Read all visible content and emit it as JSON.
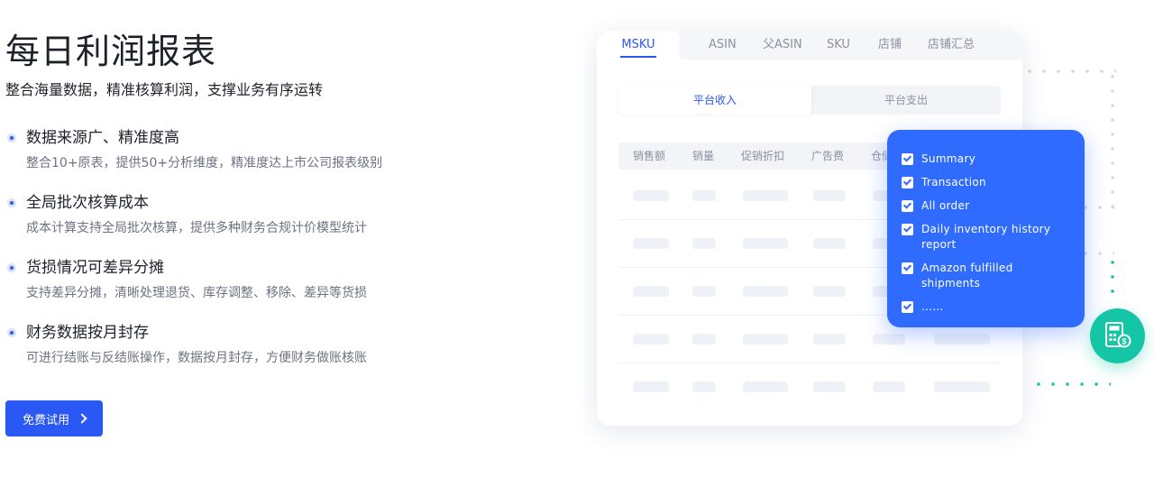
{
  "hero": {
    "title": "每日利润报表",
    "subtitle": "整合海量数据，精准核算利润，支撑业务有序运转"
  },
  "features": [
    {
      "title": "数据来源广、精准度高",
      "desc": "整合10+原表，提供50+分析维度，精准度达上市公司报表级别"
    },
    {
      "title": "全局批次核算成本",
      "desc": "成本计算支持全局批次核算，提供多种财务合规计价模型统计"
    },
    {
      "title": "货损情况可差异分摊",
      "desc": "支持差异分摊，清晰处理退货、库存调整、移除、差异等货损"
    },
    {
      "title": "财务数据按月封存",
      "desc": "可进行结账与反结账操作，数据按月封存，方便财务做账核账"
    }
  ],
  "cta": {
    "label": "免费试用"
  },
  "report_card": {
    "tabs": [
      "MSKU",
      "ASIN",
      "父ASIN",
      "SKU",
      "店铺",
      "店铺汇总"
    ],
    "active_tab": "MSKU",
    "segments": [
      "平台收入",
      "平台支出"
    ],
    "active_segment": "平台收入",
    "columns": [
      "销售额",
      "销量",
      "促销折扣",
      "广告费",
      "仓储"
    ]
  },
  "report_options": [
    "Summary",
    "Transaction",
    "All order",
    "Daily inventory history report",
    "Amazon fulfilled shipments",
    "……"
  ],
  "colors": {
    "primary": "#2958f5",
    "popup": "#2f6bff",
    "badge": "#15c6a6"
  },
  "icons": {
    "bullet": "dot-icon",
    "cta": "chevron-right-icon",
    "badge": "calculator-dollar-icon",
    "option": "checkbox-checked-icon"
  }
}
